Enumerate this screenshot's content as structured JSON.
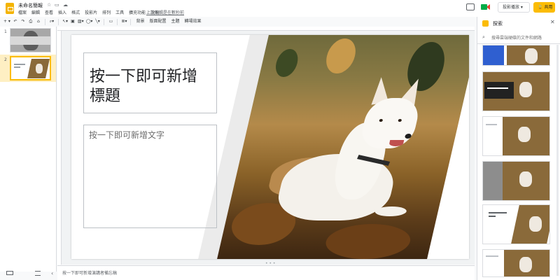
{
  "app": {
    "doc_title": "未命名簡報",
    "menu": [
      "檔案",
      "編輯",
      "查看",
      "插入",
      "格式",
      "投影片",
      "排列",
      "工具",
      "擴充功能",
      "說明"
    ],
    "last_edit": "上次編輯是在數秒前",
    "present_label": "投影播放",
    "share_label": "共用"
  },
  "toolbar": {
    "background_label": "背景",
    "layout_label": "版面配置",
    "theme_label": "主題",
    "transition_label": "轉場效果"
  },
  "filmstrip": {
    "slides": [
      {
        "number": "1"
      },
      {
        "number": "2"
      }
    ]
  },
  "slide": {
    "title": "按一下即可新增標題",
    "body": "按一下即可新增文字"
  },
  "notes": {
    "placeholder": "按一下即可新增演講者備忘稿"
  },
  "panel": {
    "title": "探索",
    "search_placeholder": "搜尋雲端硬碟的文件和網路"
  },
  "colors": {
    "accent": "#fbbc04",
    "share": "#fbbc04",
    "slide_border": "#bdc1c6"
  }
}
